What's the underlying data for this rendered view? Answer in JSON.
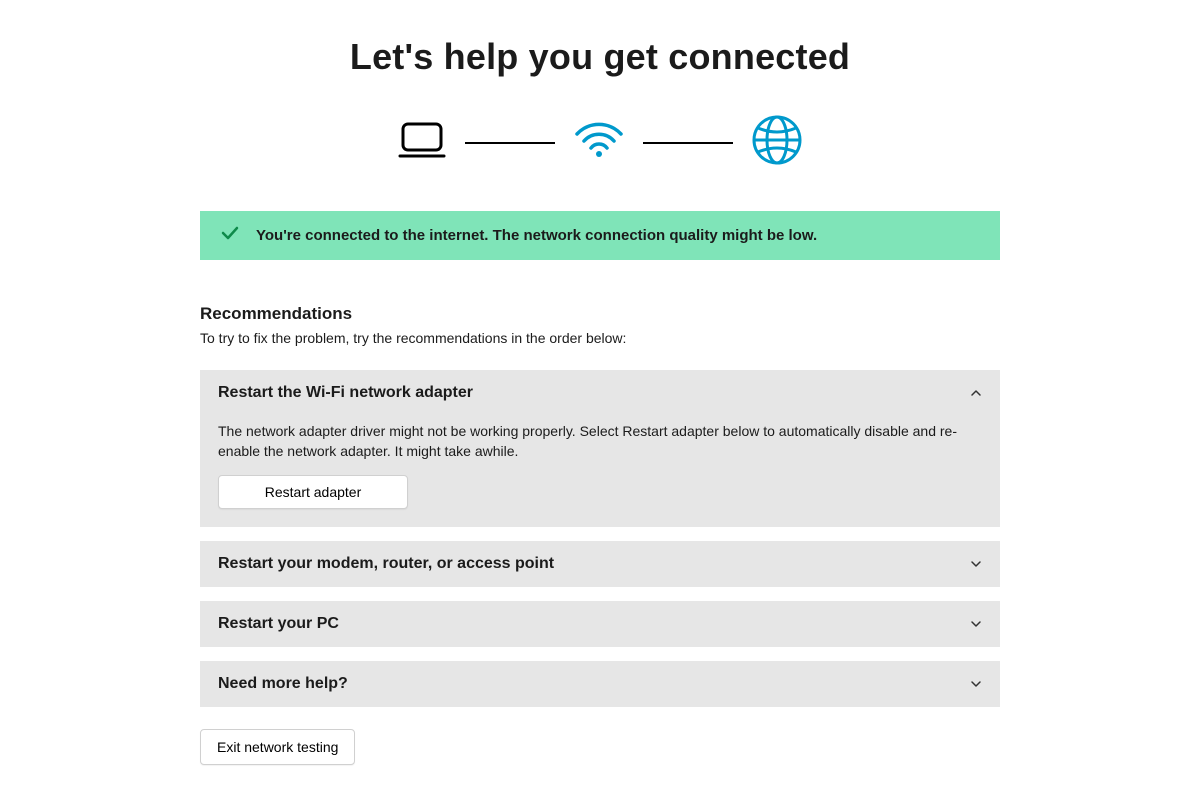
{
  "title": "Let's help you get connected",
  "status": {
    "message": "You're connected to the internet. The network connection quality might be low."
  },
  "recommendations": {
    "heading": "Recommendations",
    "subtext": "To try to fix the problem, try the recommendations in the order below:",
    "items": [
      {
        "title": "Restart the Wi-Fi network adapter",
        "expanded": true,
        "body": "The network adapter driver might not be working properly. Select Restart adapter below to automatically disable and re-enable the network adapter. It might take awhile.",
        "action_label": "Restart adapter"
      },
      {
        "title": "Restart your modem, router, or access point",
        "expanded": false
      },
      {
        "title": "Restart your PC",
        "expanded": false
      },
      {
        "title": "Need more help?",
        "expanded": false
      }
    ]
  },
  "exit_label": "Exit network testing",
  "colors": {
    "banner_bg": "#7fe4b8",
    "accent_blue": "#0099cc",
    "accordion_bg": "#e6e6e6"
  }
}
